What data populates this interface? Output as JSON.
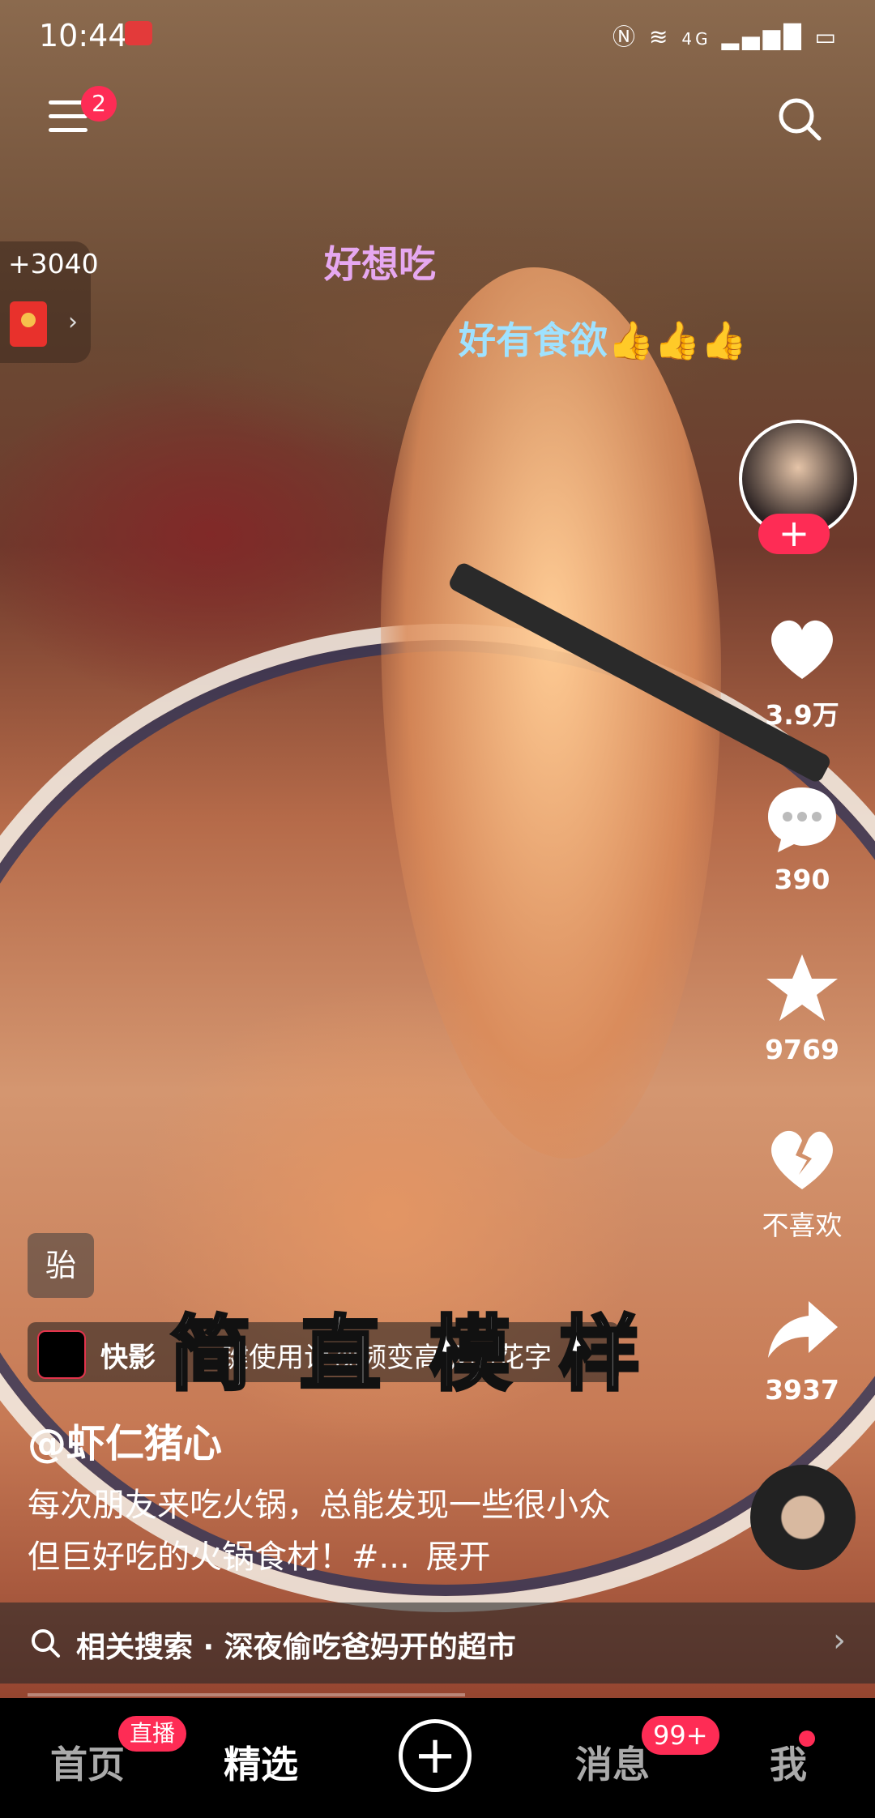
{
  "status_bar": {
    "time": "10:44",
    "network": "4G"
  },
  "top": {
    "menu_badge": "2"
  },
  "coin_widget": {
    "amount": "+3040",
    "arrow": "›"
  },
  "danmaku": [
    "好想吃",
    "好有食欲👍👍👍"
  ],
  "actions": {
    "follow": "+",
    "likes": "3.9万",
    "comments": "390",
    "favorites": "9769",
    "dislike": "不喜欢",
    "shares": "3937"
  },
  "video": {
    "tag": "骀",
    "template_app": "快影",
    "template_desc": "一键使用让视频变高级的花字",
    "caption": "简直模样",
    "author": "@虾仁猪心",
    "description": "每次朋友来吃火锅，总能发现一些很小众但巨好吃的火锅食材！#...",
    "expand": "展开"
  },
  "related_search": {
    "label": "相关搜索 · 深夜偷吃爸妈开的超市",
    "chevron": "›"
  },
  "bottom_nav": {
    "home": "首页",
    "home_badge": "直播",
    "featured": "精选",
    "add": "+",
    "messages": "消息",
    "messages_badge": "99+",
    "me": "我"
  },
  "colors": {
    "accent": "#fe2c55"
  }
}
